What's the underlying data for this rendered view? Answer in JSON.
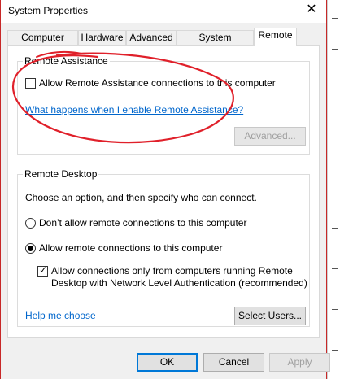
{
  "window": {
    "title": "System Properties",
    "close_glyph": "✕"
  },
  "tabs": [
    {
      "label": "Computer Name"
    },
    {
      "label": "Hardware"
    },
    {
      "label": "Advanced"
    },
    {
      "label": "System Protection"
    },
    {
      "label": "Remote"
    }
  ],
  "remote_assistance": {
    "group_title": "Remote Assistance",
    "allow_checkbox": {
      "label": "Allow Remote Assistance connections to this computer",
      "checked": false
    },
    "help_link": "What happens when I enable Remote Assistance?",
    "advanced_button": "Advanced..."
  },
  "remote_desktop": {
    "group_title": "Remote Desktop",
    "instructions": "Choose an option, and then specify who can connect.",
    "option_dont_allow": {
      "label": "Don’t allow remote connections to this computer",
      "selected": false
    },
    "option_allow": {
      "label": "Allow remote connections to this computer",
      "selected": true
    },
    "nla_checkbox": {
      "line1": "Allow connections only from computers running Remote",
      "line2": "Desktop with Network Level Authentication (recommended)",
      "checked": true
    },
    "help_link": "Help me choose",
    "select_users_button": "Select Users..."
  },
  "footer": {
    "ok": "OK",
    "cancel": "Cancel",
    "apply": "Apply"
  },
  "colors": {
    "annotation_red": "#e0202a",
    "link_blue": "#0066cc"
  }
}
